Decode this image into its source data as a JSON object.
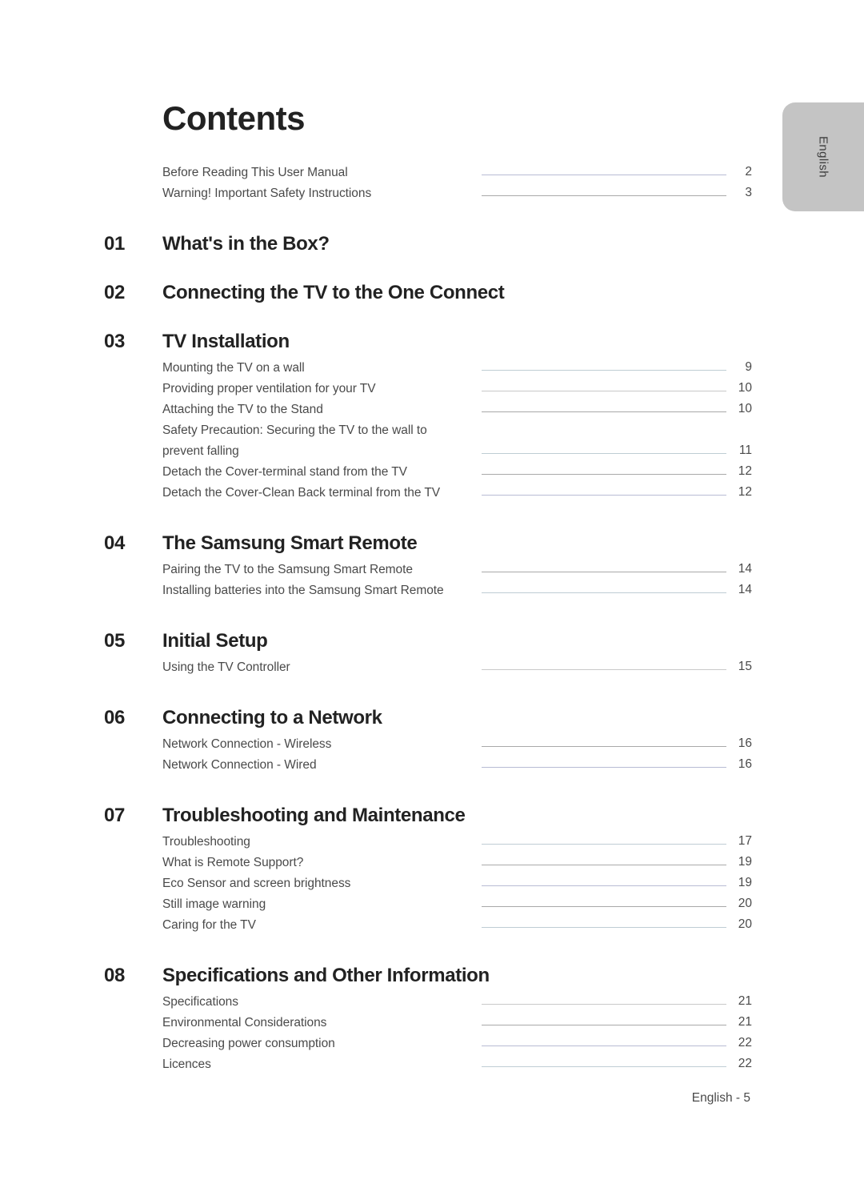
{
  "document": {
    "title": "Contents",
    "language_tab": "English",
    "footer": "English - 5"
  },
  "preface_entries": [
    {
      "label": "Before Reading This User Manual",
      "page": "2"
    },
    {
      "label": "Warning! Important Safety Instructions",
      "page": "3"
    }
  ],
  "sections": [
    {
      "number": "01",
      "title": "What's in the Box?",
      "items": []
    },
    {
      "number": "02",
      "title": "Connecting the TV to the One Connect",
      "items": []
    },
    {
      "number": "03",
      "title": "TV Installation",
      "items": [
        {
          "label": "Mounting the TV on a wall",
          "page": "9"
        },
        {
          "label": "Providing proper ventilation for your TV",
          "page": "10"
        },
        {
          "label": "Attaching the TV to the Stand",
          "page": "10"
        },
        {
          "label": "Safety Precaution: Securing the TV to the wall to",
          "page": ""
        },
        {
          "label": "prevent falling",
          "page": "11"
        },
        {
          "label": "Detach the Cover-terminal stand from the TV",
          "page": "12"
        },
        {
          "label": "Detach the Cover-Clean Back terminal from the TV",
          "page": "12"
        }
      ]
    },
    {
      "number": "04",
      "title": "The Samsung Smart Remote",
      "items": [
        {
          "label": "Pairing the TV to the Samsung Smart Remote",
          "page": "14"
        },
        {
          "label": "Installing batteries into the Samsung Smart Remote",
          "page": "14"
        }
      ]
    },
    {
      "number": "05",
      "title": "Initial Setup",
      "items": [
        {
          "label": "Using the TV Controller",
          "page": "15"
        }
      ]
    },
    {
      "number": "06",
      "title": "Connecting to a Network",
      "items": [
        {
          "label": "Network Connection - Wireless",
          "page": "16"
        },
        {
          "label": "Network Connection - Wired",
          "page": "16"
        }
      ]
    },
    {
      "number": "07",
      "title": "Troubleshooting and Maintenance",
      "items": [
        {
          "label": "Troubleshooting",
          "page": "17"
        },
        {
          "label": "What is Remote Support?",
          "page": "19"
        },
        {
          "label": "Eco Sensor and screen brightness",
          "page": "19"
        },
        {
          "label": "Still image warning",
          "page": "20"
        },
        {
          "label": "Caring for the TV",
          "page": "20"
        }
      ]
    },
    {
      "number": "08",
      "title": "Specifications and Other Information",
      "items": [
        {
          "label": "Specifications",
          "page": "21"
        },
        {
          "label": "Environmental Considerations",
          "page": "21"
        },
        {
          "label": "Decreasing power consumption",
          "page": "22"
        },
        {
          "label": "Licences",
          "page": "22"
        }
      ]
    }
  ]
}
